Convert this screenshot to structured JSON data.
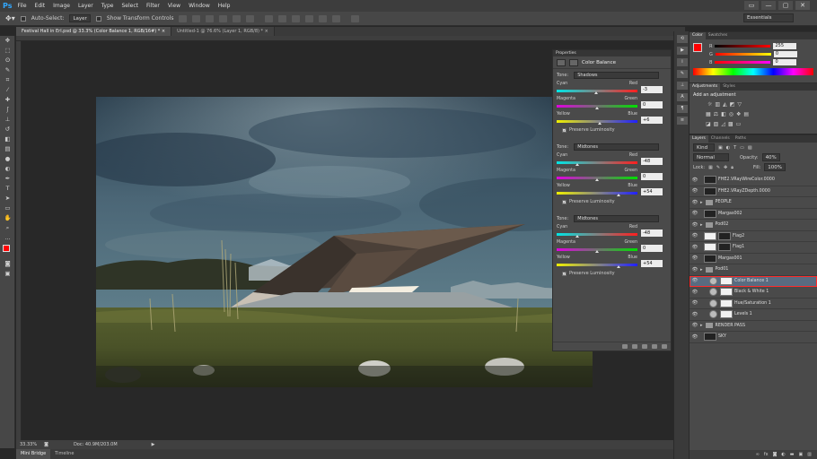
{
  "app": {
    "logo": "Ps",
    "menus": [
      "File",
      "Edit",
      "Image",
      "Layer",
      "Type",
      "Select",
      "Filter",
      "View",
      "Window",
      "Help"
    ],
    "window_buttons": [
      "▭",
      "—",
      "▢",
      "✕"
    ]
  },
  "options": {
    "auto_select_label": "Auto-Select:",
    "auto_select_value": "Layer",
    "transform_label": "Show Transform Controls",
    "workspace": "Essentials"
  },
  "tabs": [
    {
      "label": "Festival Hall in Erl.psd @ 33.3% (Color Balance 1, RGB/16#) * ×"
    },
    {
      "label": "Untitled-1 @ 76.6% (Layer 1, RGB/8) * ×"
    }
  ],
  "status": {
    "zoom": "33.33%",
    "doc": "Doc: 40.9M/203.0M"
  },
  "bottom_tabs": [
    "Mini Bridge",
    "Timeline"
  ],
  "properties": {
    "panel_label": "Properties",
    "title": "Color Balance",
    "tone_label": "Tone:",
    "preserve_label": "Preserve Luminosity",
    "blocks": [
      {
        "tone": "Shadows",
        "sliders": [
          {
            "left": "Cyan",
            "right": "Red",
            "value": "-3",
            "pct": 0.485
          },
          {
            "left": "Magenta",
            "right": "Green",
            "value": "0",
            "pct": 0.5
          },
          {
            "left": "Yellow",
            "right": "Blue",
            "value": "+6",
            "pct": 0.53
          }
        ]
      },
      {
        "tone": "Midtones",
        "sliders": [
          {
            "left": "Cyan",
            "right": "Red",
            "value": "-48",
            "pct": 0.26
          },
          {
            "left": "Magenta",
            "right": "Green",
            "value": "0",
            "pct": 0.5
          },
          {
            "left": "Yellow",
            "right": "Blue",
            "value": "+54",
            "pct": 0.77
          }
        ]
      },
      {
        "tone": "Midtones",
        "sliders": [
          {
            "left": "Cyan",
            "right": "Red",
            "value": "-48",
            "pct": 0.26
          },
          {
            "left": "Magenta",
            "right": "Green",
            "value": "0",
            "pct": 0.5
          },
          {
            "left": "Yellow",
            "right": "Blue",
            "value": "+54",
            "pct": 0.77
          }
        ]
      }
    ]
  },
  "color_panel": {
    "tabs": [
      "Color",
      "Swatches"
    ],
    "channels": [
      {
        "label": "R",
        "value": "255"
      },
      {
        "label": "G",
        "value": "0"
      },
      {
        "label": "B",
        "value": "0"
      }
    ],
    "foreground": "#ff0000"
  },
  "adjustments_panel": {
    "tabs": [
      "Adjustments",
      "Styles"
    ],
    "title": "Add an adjustment"
  },
  "layers_panel": {
    "tabs": [
      "Layers",
      "Channels",
      "Paths"
    ],
    "kind": "Kind",
    "blend": "Normal",
    "opacity_label": "Opacity:",
    "opacity": "40%",
    "lock_label": "Lock:",
    "fill_label": "Fill:",
    "fill": "100%",
    "layers": [
      {
        "name": "FHE2.VRayWireColor.0000",
        "type": "image"
      },
      {
        "name": "FHE2.VRayZDepth.0000",
        "type": "image"
      },
      {
        "name": "PEOPLE",
        "type": "group"
      },
      {
        "name": "Margas002",
        "type": "image"
      },
      {
        "name": "Pod02",
        "type": "group"
      },
      {
        "name": "Flag2",
        "type": "mask"
      },
      {
        "name": "Flag1",
        "type": "mask"
      },
      {
        "name": "Margas001",
        "type": "image"
      },
      {
        "name": "Pod01",
        "type": "group"
      },
      {
        "name": "Color Balance 1",
        "type": "adj",
        "selected": true
      },
      {
        "name": "Black & White 1",
        "type": "adj"
      },
      {
        "name": "Hue/Saturation 1",
        "type": "adj"
      },
      {
        "name": "Levels 1",
        "type": "adj"
      },
      {
        "name": "RENDER PASS",
        "type": "group"
      },
      {
        "name": "SKY",
        "type": "image"
      }
    ]
  }
}
